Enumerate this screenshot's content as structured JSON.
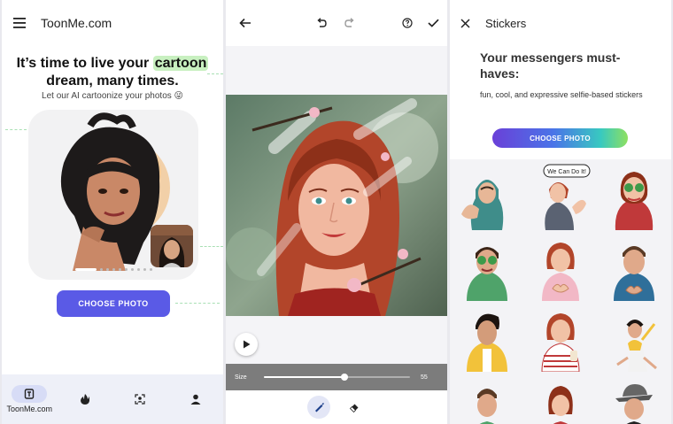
{
  "panel1": {
    "app_title": "ToonMe.com",
    "headline_part1": "It’s time to live your ",
    "headline_highlight": "cartoon",
    "headline_part2": "dream, many times.",
    "subtitle": "Let our AI cartoonize your photos 😜",
    "choose_photo_label": "CHOOSE PHOTO",
    "carousel": {
      "dot_count": 10,
      "active_index": 0
    },
    "bottom_nav": [
      {
        "label": "ToonMe.com",
        "icon": "toonme-logo-icon",
        "active": true
      },
      {
        "label": "",
        "icon": "flame-icon",
        "active": false
      },
      {
        "label": "",
        "icon": "person-frame-icon",
        "active": false
      },
      {
        "label": "",
        "icon": "person-icon",
        "active": false
      }
    ]
  },
  "panel2": {
    "size_label": "Size",
    "size_value": "55",
    "size_max": "100",
    "tools": [
      {
        "icon": "brush-icon",
        "active": true
      },
      {
        "icon": "eraser-icon",
        "active": false
      }
    ]
  },
  "panel3": {
    "title": "Stickers",
    "headline": "Your messengers must-haves:",
    "subtitle": "fun, cool, and expressive selfie-based stickers",
    "choose_photo_label": "CHOOSE PHOTO",
    "sticker_bubble_text": "We Can Do It!"
  },
  "colors": {
    "primary": "#5a5ae6",
    "highlight": "#c8f0c0",
    "nav_bg": "#eef0f8",
    "size_bar": "#7c7c7c"
  }
}
